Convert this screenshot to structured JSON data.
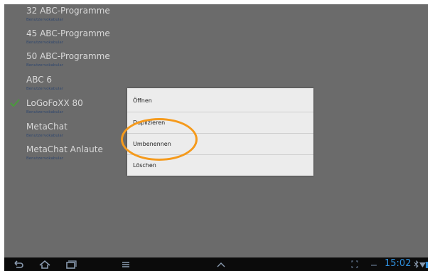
{
  "list": {
    "items": [
      {
        "title": "32 ABC-Programme",
        "subtitle": "Benutzervokabular",
        "checked": false
      },
      {
        "title": "45 ABC-Programme",
        "subtitle": "Benutzervokabular",
        "checked": false
      },
      {
        "title": "50 ABC-Programme",
        "subtitle": "Benutzervokabular",
        "checked": false
      },
      {
        "title": "ABC 6",
        "subtitle": "Benutzervokabular",
        "checked": false
      },
      {
        "title": "LoGoFoXX 80",
        "subtitle": "Benutzervokabular",
        "checked": true
      },
      {
        "title": "MetaChat",
        "subtitle": "Benutzervokabular",
        "checked": false
      },
      {
        "title": "MetaChat Anlaute",
        "subtitle": "Benutzervokabular",
        "checked": false
      }
    ]
  },
  "dialog": {
    "options": [
      "Öffnen",
      "Duplizieren",
      "Umbenennen",
      "Löschen"
    ]
  },
  "navbar": {
    "time": "15:02"
  },
  "colors": {
    "accent": "#2f8fdc",
    "highlight": "#f59a1c",
    "check": "#4a9a3c"
  }
}
